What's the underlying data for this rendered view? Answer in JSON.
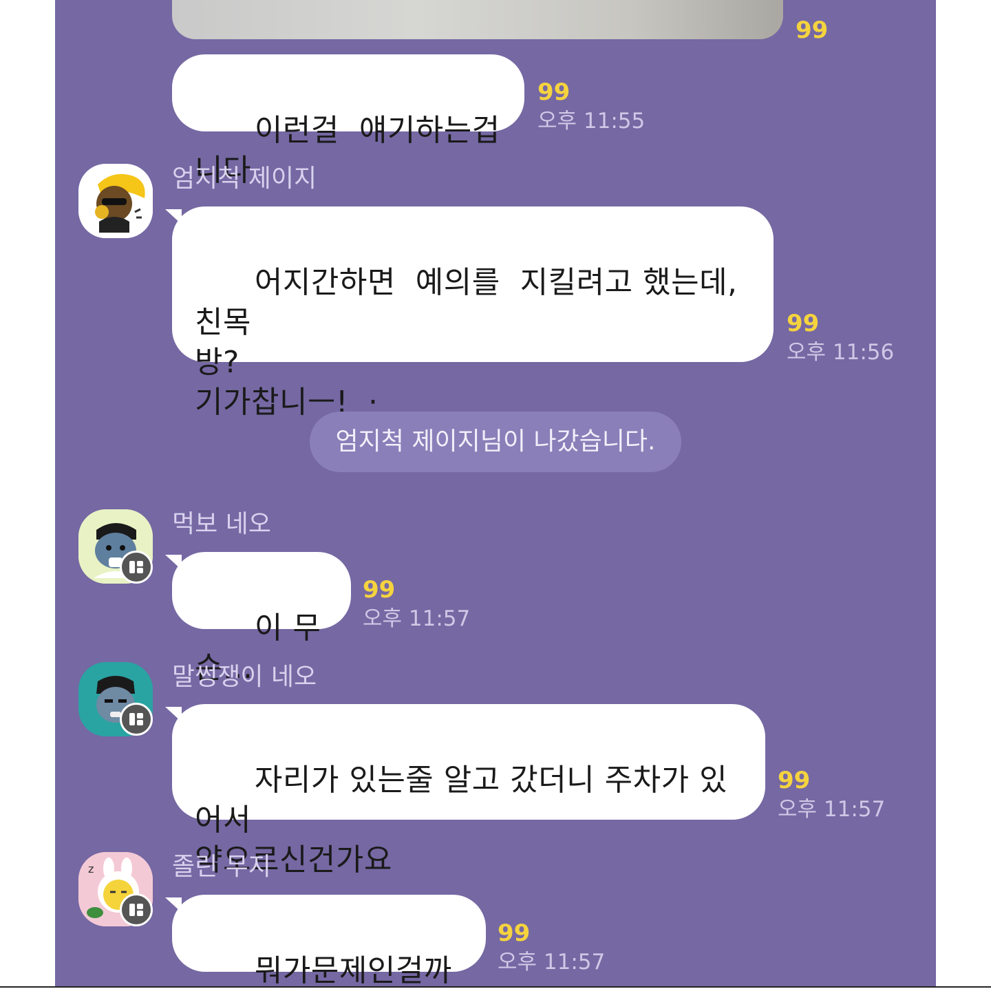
{
  "colors": {
    "chat_background": "#7568a3",
    "bubble": "#ffffff",
    "read_count": "#f5d33f",
    "system_pill": "#8a7fb8"
  },
  "messages": [
    {
      "read": "99"
    },
    {
      "text": "이런걸  얘기하는겁니다",
      "read": "99",
      "time": "오후 11:55"
    },
    {
      "sender": "엄지척 제이지",
      "avatar_icon": "jay-g-thumbs-up-avatar-icon",
      "text": "어지간하면  예의를  지킬려고 했는데, 친목\n방?\n기가찹니ㅡ!  ·",
      "read": "99",
      "time": "오후 11:56"
    },
    {
      "sender": "먹보 네오",
      "avatar_icon": "neo-eating-avatar-icon",
      "text": "이 무슨...",
      "read": "99",
      "time": "오후 11:57"
    },
    {
      "sender": "말썽쟁이 네오",
      "avatar_icon": "neo-troublemaker-avatar-icon",
      "text": "자리가 있는줄 알고 갔더니 주차가 있어서\n약오르신건가요",
      "read": "99",
      "time": "오후 11:57"
    },
    {
      "sender": "졸린 무지",
      "avatar_icon": "muzi-sleepy-avatar-icon",
      "text": "뭐가문제인걸까요..?",
      "read": "99",
      "time": "오후 11:57"
    }
  ],
  "system": {
    "notice": "엄지척 제이지님이 나갔습니다."
  }
}
